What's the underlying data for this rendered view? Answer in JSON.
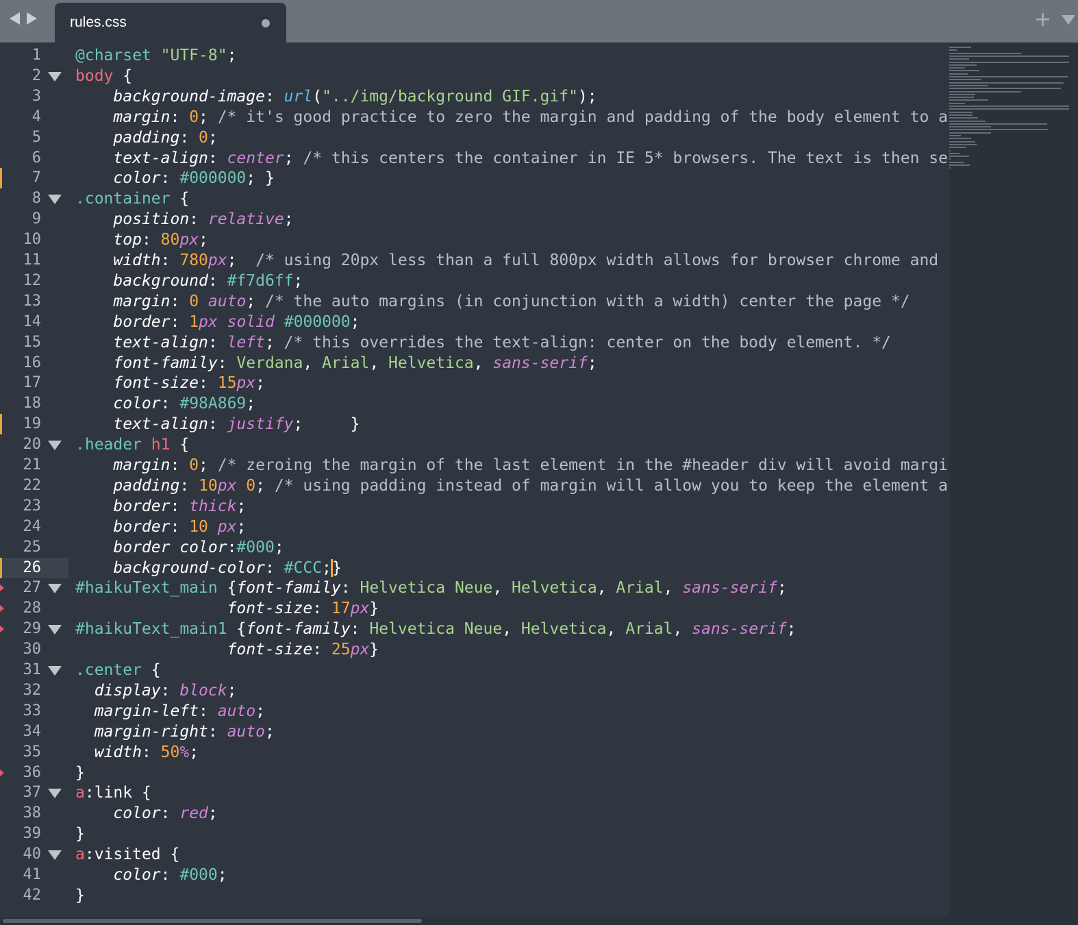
{
  "tab": {
    "title": "rules.css",
    "modified": true
  },
  "icons": {
    "back": "chevron-left-icon",
    "forward": "chevron-right-icon",
    "new_tab": "plus-icon",
    "menu": "chevron-down-icon"
  },
  "current_line": 26,
  "lines": [
    {
      "n": "1",
      "code": [
        [
          "at",
          "@charset"
        ],
        [
          "pl",
          " "
        ],
        [
          "str",
          "\"UTF-8\""
        ],
        [
          "pl",
          ";"
        ]
      ]
    },
    {
      "n": "2",
      "fold": true,
      "code": [
        [
          "tag",
          "body"
        ],
        [
          "pl",
          " "
        ],
        [
          "br",
          "{"
        ]
      ]
    },
    {
      "n": "3",
      "code": [
        [
          "pl",
          "    "
        ],
        [
          "prop",
          "background-image"
        ],
        [
          "pl",
          ": "
        ],
        [
          "fn",
          "url"
        ],
        [
          "pl",
          "("
        ],
        [
          "str",
          "\"../img/background GIF.gif\""
        ],
        [
          "pl",
          ");"
        ]
      ]
    },
    {
      "n": "4",
      "code": [
        [
          "pl",
          "    "
        ],
        [
          "prop",
          "margin"
        ],
        [
          "pl",
          ": "
        ],
        [
          "num",
          "0"
        ],
        [
          "pl",
          "; "
        ],
        [
          "cmt",
          "/* it's good practice to zero the margin and padding of the body element to a"
        ]
      ]
    },
    {
      "n": "5",
      "code": [
        [
          "pl",
          "    "
        ],
        [
          "prop",
          "padding"
        ],
        [
          "pl",
          ": "
        ],
        [
          "num",
          "0"
        ],
        [
          "pl",
          ";"
        ]
      ]
    },
    {
      "n": "6",
      "code": [
        [
          "pl",
          "    "
        ],
        [
          "prop",
          "text-align"
        ],
        [
          "pl",
          ": "
        ],
        [
          "kw",
          "center"
        ],
        [
          "pl",
          "; "
        ],
        [
          "cmt",
          "/* this centers the container in IE 5* browsers. The text is then se"
        ]
      ]
    },
    {
      "n": "7",
      "mod": true,
      "code": [
        [
          "pl",
          "    "
        ],
        [
          "prop",
          "color"
        ],
        [
          "pl",
          ": "
        ],
        [
          "hex",
          "#000000"
        ],
        [
          "pl",
          "; "
        ],
        [
          "br",
          "}"
        ]
      ]
    },
    {
      "n": "8",
      "fold": true,
      "code": [
        [
          "cls",
          ".container"
        ],
        [
          "pl",
          " "
        ],
        [
          "br",
          "{"
        ]
      ]
    },
    {
      "n": "9",
      "code": [
        [
          "pl",
          "    "
        ],
        [
          "prop",
          "position"
        ],
        [
          "pl",
          ": "
        ],
        [
          "kw",
          "relative"
        ],
        [
          "pl",
          ";"
        ]
      ]
    },
    {
      "n": "10",
      "code": [
        [
          "pl",
          "    "
        ],
        [
          "prop",
          "top"
        ],
        [
          "pl",
          ": "
        ],
        [
          "num",
          "80"
        ],
        [
          "unit",
          "px"
        ],
        [
          "pl",
          ";"
        ]
      ]
    },
    {
      "n": "11",
      "code": [
        [
          "pl",
          "    "
        ],
        [
          "prop",
          "width"
        ],
        [
          "pl",
          ": "
        ],
        [
          "num",
          "780"
        ],
        [
          "unit",
          "px"
        ],
        [
          "pl",
          ";  "
        ],
        [
          "cmt",
          "/* using 20px less than a full 800px width allows for browser chrome and"
        ]
      ]
    },
    {
      "n": "12",
      "code": [
        [
          "pl",
          "    "
        ],
        [
          "prop",
          "background"
        ],
        [
          "pl",
          ": "
        ],
        [
          "hex",
          "#f7d6ff"
        ],
        [
          "pl",
          ";"
        ]
      ]
    },
    {
      "n": "13",
      "code": [
        [
          "pl",
          "    "
        ],
        [
          "prop",
          "margin"
        ],
        [
          "pl",
          ": "
        ],
        [
          "num",
          "0"
        ],
        [
          "pl",
          " "
        ],
        [
          "kw",
          "auto"
        ],
        [
          "pl",
          "; "
        ],
        [
          "cmt",
          "/* the auto margins (in conjunction with a width) center the page */"
        ]
      ]
    },
    {
      "n": "14",
      "code": [
        [
          "pl",
          "    "
        ],
        [
          "prop",
          "border"
        ],
        [
          "pl",
          ": "
        ],
        [
          "num",
          "1"
        ],
        [
          "unit",
          "px"
        ],
        [
          "pl",
          " "
        ],
        [
          "kw",
          "solid"
        ],
        [
          "pl",
          " "
        ],
        [
          "hex",
          "#000000"
        ],
        [
          "pl",
          ";"
        ]
      ]
    },
    {
      "n": "15",
      "code": [
        [
          "pl",
          "    "
        ],
        [
          "prop",
          "text-align"
        ],
        [
          "pl",
          ": "
        ],
        [
          "kw",
          "left"
        ],
        [
          "pl",
          "; "
        ],
        [
          "cmt",
          "/* this overrides the text-align: center on the body element. */"
        ]
      ]
    },
    {
      "n": "16",
      "code": [
        [
          "pl",
          "    "
        ],
        [
          "prop",
          "font-family"
        ],
        [
          "pl",
          ": "
        ],
        [
          "font",
          "Verdana"
        ],
        [
          "pl",
          ", "
        ],
        [
          "font",
          "Arial"
        ],
        [
          "pl",
          ", "
        ],
        [
          "font",
          "Helvetica"
        ],
        [
          "pl",
          ", "
        ],
        [
          "kw",
          "sans-serif"
        ],
        [
          "pl",
          ";"
        ]
      ]
    },
    {
      "n": "17",
      "code": [
        [
          "pl",
          "    "
        ],
        [
          "prop",
          "font-size"
        ],
        [
          "pl",
          ": "
        ],
        [
          "num",
          "15"
        ],
        [
          "unit",
          "px"
        ],
        [
          "pl",
          ";"
        ]
      ]
    },
    {
      "n": "18",
      "code": [
        [
          "pl",
          "    "
        ],
        [
          "prop",
          "color"
        ],
        [
          "pl",
          ": "
        ],
        [
          "hex",
          "#98A869"
        ],
        [
          "pl",
          ";"
        ]
      ]
    },
    {
      "n": "19",
      "mod": true,
      "code": [
        [
          "pl",
          "    "
        ],
        [
          "prop",
          "text-align"
        ],
        [
          "pl",
          ": "
        ],
        [
          "kw",
          "justify"
        ],
        [
          "pl",
          ";     "
        ],
        [
          "br",
          "}"
        ]
      ]
    },
    {
      "n": "20",
      "fold": true,
      "code": [
        [
          "cls",
          ".header"
        ],
        [
          "pl",
          " "
        ],
        [
          "tag",
          "h1"
        ],
        [
          "pl",
          " "
        ],
        [
          "br",
          "{"
        ]
      ]
    },
    {
      "n": "21",
      "code": [
        [
          "pl",
          "    "
        ],
        [
          "prop",
          "margin"
        ],
        [
          "pl",
          ": "
        ],
        [
          "num",
          "0"
        ],
        [
          "pl",
          "; "
        ],
        [
          "cmt",
          "/* zeroing the margin of the last element in the #header div will avoid margi"
        ]
      ]
    },
    {
      "n": "22",
      "code": [
        [
          "pl",
          "    "
        ],
        [
          "prop",
          "padding"
        ],
        [
          "pl",
          ": "
        ],
        [
          "num",
          "10"
        ],
        [
          "unit",
          "px"
        ],
        [
          "pl",
          " "
        ],
        [
          "num",
          "0"
        ],
        [
          "pl",
          "; "
        ],
        [
          "cmt",
          "/* using padding instead of margin will allow you to keep the element a"
        ]
      ]
    },
    {
      "n": "23",
      "code": [
        [
          "pl",
          "    "
        ],
        [
          "prop",
          "border"
        ],
        [
          "pl",
          ": "
        ],
        [
          "kw",
          "thick"
        ],
        [
          "pl",
          ";"
        ]
      ]
    },
    {
      "n": "24",
      "code": [
        [
          "pl",
          "    "
        ],
        [
          "prop",
          "border"
        ],
        [
          "pl",
          ": "
        ],
        [
          "num",
          "10"
        ],
        [
          "pl",
          " "
        ],
        [
          "unit",
          "px"
        ],
        [
          "pl",
          ";"
        ]
      ]
    },
    {
      "n": "25",
      "code": [
        [
          "pl",
          "    "
        ],
        [
          "prop",
          "border color"
        ],
        [
          "pl",
          ":"
        ],
        [
          "hex",
          "#000"
        ],
        [
          "pl",
          ";"
        ]
      ]
    },
    {
      "n": "26",
      "mod": true,
      "current": true,
      "code": [
        [
          "pl",
          "    "
        ],
        [
          "prop",
          "background-color"
        ],
        [
          "pl",
          ": "
        ],
        [
          "hex",
          "#CCC"
        ],
        [
          "pl",
          ";"
        ],
        [
          "cursor",
          ""
        ],
        [
          "br",
          "}"
        ]
      ]
    },
    {
      "n": "27",
      "fold": true,
      "del": true,
      "code": [
        [
          "hex",
          "#haikuText_main"
        ],
        [
          "pl",
          " "
        ],
        [
          "br",
          "{"
        ],
        [
          "prop",
          "font-family"
        ],
        [
          "pl",
          ": "
        ],
        [
          "font",
          "Helvetica Neue"
        ],
        [
          "pl",
          ", "
        ],
        [
          "font",
          "Helvetica"
        ],
        [
          "pl",
          ", "
        ],
        [
          "font",
          "Arial"
        ],
        [
          "pl",
          ", "
        ],
        [
          "kw",
          "sans-serif"
        ],
        [
          "pl",
          ";"
        ]
      ]
    },
    {
      "n": "28",
      "del": true,
      "code": [
        [
          "pl",
          "                "
        ],
        [
          "prop",
          "font-size"
        ],
        [
          "pl",
          ": "
        ],
        [
          "num",
          "17"
        ],
        [
          "unit",
          "px"
        ],
        [
          "br",
          "}"
        ]
      ]
    },
    {
      "n": "29",
      "fold": true,
      "del": true,
      "code": [
        [
          "hex",
          "#haikuText_main1"
        ],
        [
          "pl",
          " "
        ],
        [
          "br",
          "{"
        ],
        [
          "prop",
          "font-family"
        ],
        [
          "pl",
          ": "
        ],
        [
          "font",
          "Helvetica Neue"
        ],
        [
          "pl",
          ", "
        ],
        [
          "font",
          "Helvetica"
        ],
        [
          "pl",
          ", "
        ],
        [
          "font",
          "Arial"
        ],
        [
          "pl",
          ", "
        ],
        [
          "kw",
          "sans-serif"
        ],
        [
          "pl",
          ";"
        ]
      ]
    },
    {
      "n": "30",
      "code": [
        [
          "pl",
          "                "
        ],
        [
          "prop",
          "font-size"
        ],
        [
          "pl",
          ": "
        ],
        [
          "num",
          "25"
        ],
        [
          "unit",
          "px"
        ],
        [
          "br",
          "}"
        ]
      ]
    },
    {
      "n": "31",
      "fold": true,
      "code": [
        [
          "cls",
          ".center"
        ],
        [
          "pl",
          " "
        ],
        [
          "br",
          "{"
        ]
      ]
    },
    {
      "n": "32",
      "code": [
        [
          "pl",
          "  "
        ],
        [
          "prop",
          "display"
        ],
        [
          "pl",
          ": "
        ],
        [
          "kw",
          "block"
        ],
        [
          "pl",
          ";"
        ]
      ]
    },
    {
      "n": "33",
      "code": [
        [
          "pl",
          "  "
        ],
        [
          "prop",
          "margin-left"
        ],
        [
          "pl",
          ": "
        ],
        [
          "kw",
          "auto"
        ],
        [
          "pl",
          ";"
        ]
      ]
    },
    {
      "n": "34",
      "code": [
        [
          "pl",
          "  "
        ],
        [
          "prop",
          "margin-right"
        ],
        [
          "pl",
          ": "
        ],
        [
          "kw",
          "auto"
        ],
        [
          "pl",
          ";"
        ]
      ]
    },
    {
      "n": "35",
      "code": [
        [
          "pl",
          "  "
        ],
        [
          "prop",
          "width"
        ],
        [
          "pl",
          ": "
        ],
        [
          "num",
          "50"
        ],
        [
          "unit",
          "%"
        ],
        [
          "pl",
          ";"
        ]
      ]
    },
    {
      "n": "36",
      "del": true,
      "code": [
        [
          "br",
          "}"
        ]
      ]
    },
    {
      "n": "37",
      "fold": true,
      "code": [
        [
          "tag",
          "a"
        ],
        [
          "pl",
          ":link "
        ],
        [
          "br",
          "{"
        ]
      ]
    },
    {
      "n": "38",
      "code": [
        [
          "pl",
          "    "
        ],
        [
          "prop",
          "color"
        ],
        [
          "pl",
          ": "
        ],
        [
          "kw",
          "red"
        ],
        [
          "pl",
          ";"
        ]
      ]
    },
    {
      "n": "39",
      "code": [
        [
          "br",
          "}"
        ]
      ]
    },
    {
      "n": "40",
      "fold": true,
      "code": [
        [
          "tag",
          "a"
        ],
        [
          "pl",
          ":visited "
        ],
        [
          "br",
          "{"
        ]
      ]
    },
    {
      "n": "41",
      "code": [
        [
          "pl",
          "    "
        ],
        [
          "prop",
          "color"
        ],
        [
          "pl",
          ": "
        ],
        [
          "hex",
          "#000"
        ],
        [
          "pl",
          ";"
        ]
      ]
    },
    {
      "n": "42",
      "code": [
        [
          "br",
          "}"
        ]
      ]
    }
  ]
}
